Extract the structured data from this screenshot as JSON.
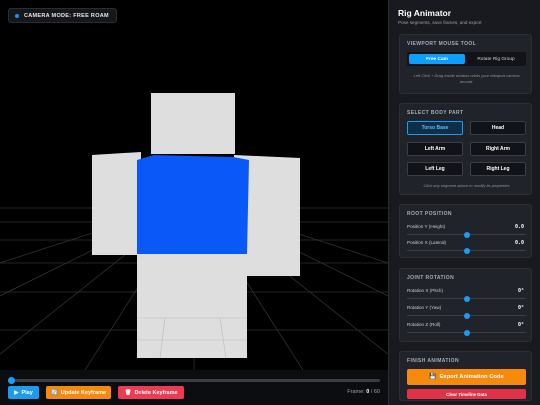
{
  "viewport": {
    "camera_badge": "CAMERA MODE: FREE ROAM",
    "colors": {
      "background": "#000000",
      "grid": "#2e3036",
      "body": "#dedede",
      "highlight": "#0a58f8"
    }
  },
  "timeline": {
    "progress": 0,
    "play_label": "Play",
    "play_icon": "play-icon",
    "update_label": "Update Keyframe",
    "update_icon": "refresh-icon",
    "delete_label": "Delete Keyframe",
    "delete_icon": "trash-icon",
    "frame_label": "Frame:",
    "frame_current": "0",
    "frame_total": "/ 60"
  },
  "panel": {
    "title": "Rig Animator",
    "subtitle": "Pose segments, save frames, and export",
    "mouse_tool": {
      "heading": "VIEWPORT MOUSE TOOL",
      "option_a": "Free Cam",
      "option_b": "Rotate Rig Group",
      "selected": "Free Cam",
      "hint": "Left Click + Drag inside window orbits your viewport camera around."
    },
    "body_part": {
      "heading": "SELECT BODY PART",
      "parts": [
        "Torso Base",
        "Head",
        "Left Arm",
        "Right Arm",
        "Left Leg",
        "Right Leg"
      ],
      "selected": "Torso Base",
      "hint": "Click any segment above to modify its properties"
    },
    "root_position": {
      "heading": "ROOT POSITION",
      "rows": [
        {
          "label": "Position Y (Height)",
          "value": "0.0",
          "fraction": 0.5
        },
        {
          "label": "Position X (Lateral)",
          "value": "0.0",
          "fraction": 0.5
        }
      ]
    },
    "joint_rotation": {
      "heading": "JOINT ROTATION",
      "rows": [
        {
          "label": "Rotation X (Pitch)",
          "value": "0°",
          "fraction": 0.5
        },
        {
          "label": "Rotation Y (Yaw)",
          "value": "0°",
          "fraction": 0.5
        },
        {
          "label": "Rotation Z (Roll)",
          "value": "0°",
          "fraction": 0.5
        }
      ]
    },
    "finish": {
      "heading": "FINISH ANIMATION",
      "export_label": "Export Animation Code",
      "export_icon": "floppy-disk-icon",
      "clear_label": "Clear Timeline Data"
    },
    "colors": {
      "accent": "#0aa0ff",
      "orange": "#f58a0b",
      "red": "#e23248"
    }
  }
}
